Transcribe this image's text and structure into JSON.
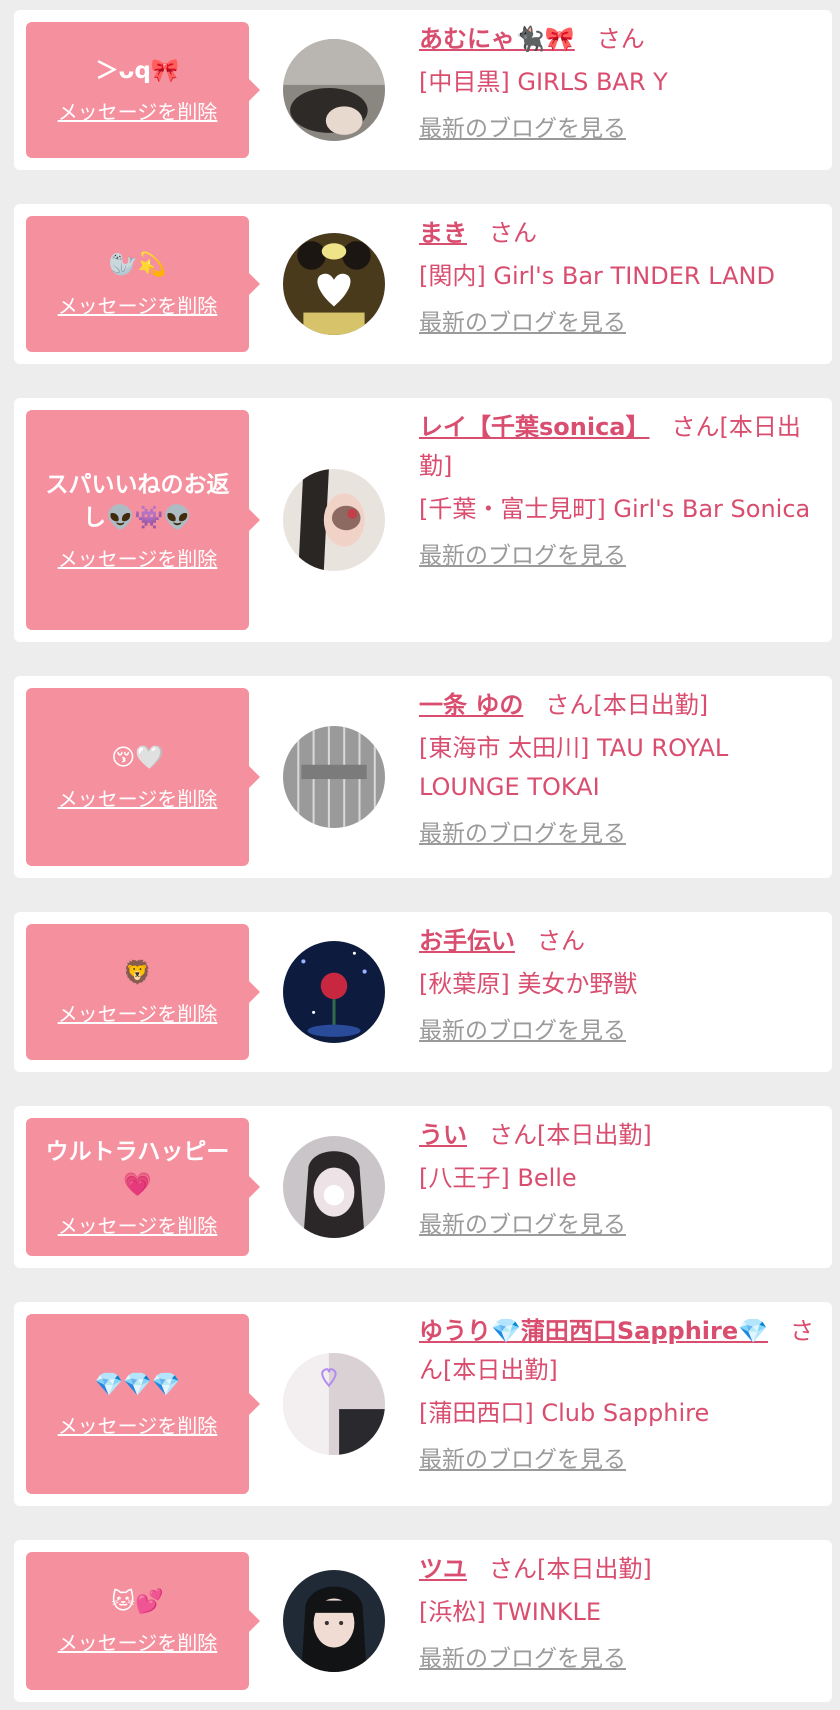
{
  "entries": [
    {
      "message": "＞ᴗq🎀",
      "delete_label": "メッセージを削除",
      "name": "あむにゃ🐈‍⬛🎀",
      "honorific": "さん",
      "status": "",
      "shop": "[中目黒] GIRLS BAR Y",
      "blog_label": "最新のブログを見る"
    },
    {
      "message": "🦭💫",
      "delete_label": "メッセージを削除",
      "name": "まき",
      "honorific": "さん",
      "status": "",
      "shop": "[関内] Girl's Bar TINDER LAND",
      "blog_label": "最新のブログを見る"
    },
    {
      "message": "スパいいねのお返し👽👾👽",
      "delete_label": "メッセージを削除",
      "name": "レイ【千葉sonica】",
      "honorific": "さん",
      "status": "[本日出勤]",
      "shop": "[千葉・富士見町] Girl's Bar Sonica",
      "blog_label": "最新のブログを見る"
    },
    {
      "message": "😚🤍",
      "delete_label": "メッセージを削除",
      "name": "一条 ゆの",
      "honorific": "さん",
      "status": "[本日出勤]",
      "shop": "[東海市 太田川] TAU ROYAL LOUNGE TOKAI",
      "blog_label": "最新のブログを見る"
    },
    {
      "message": "🦁",
      "delete_label": "メッセージを削除",
      "name": "お手伝い",
      "honorific": "さん",
      "status": "",
      "shop": "[秋葉原] 美女か野獣",
      "blog_label": "最新のブログを見る"
    },
    {
      "message": "ウルトラハッピー💗",
      "delete_label": "メッセージを削除",
      "name": "うい",
      "honorific": "さん",
      "status": "[本日出勤]",
      "shop": "[八王子] Belle",
      "blog_label": "最新のブログを見る"
    },
    {
      "message": "💎💎💎",
      "delete_label": "メッセージを削除",
      "name": "ゆうり💎蒲田西口Sapphire💎",
      "honorific": "さん",
      "status": "[本日出勤]",
      "shop": "[蒲田西口] Club Sapphire",
      "blog_label": "最新のブログを見る"
    },
    {
      "message": "🐱💕",
      "delete_label": "メッセージを削除",
      "name": "ツユ",
      "honorific": "さん",
      "status": "[本日出勤]",
      "shop": "[浜松] TWINKLE",
      "blog_label": "最新のブログを見る"
    }
  ],
  "colors": {
    "page_bg": "#ededed",
    "card_bg": "#ffffff",
    "bubble_bg": "#f5909e",
    "accent_text": "#d94d6f",
    "link_gray": "#9a9a9a"
  }
}
